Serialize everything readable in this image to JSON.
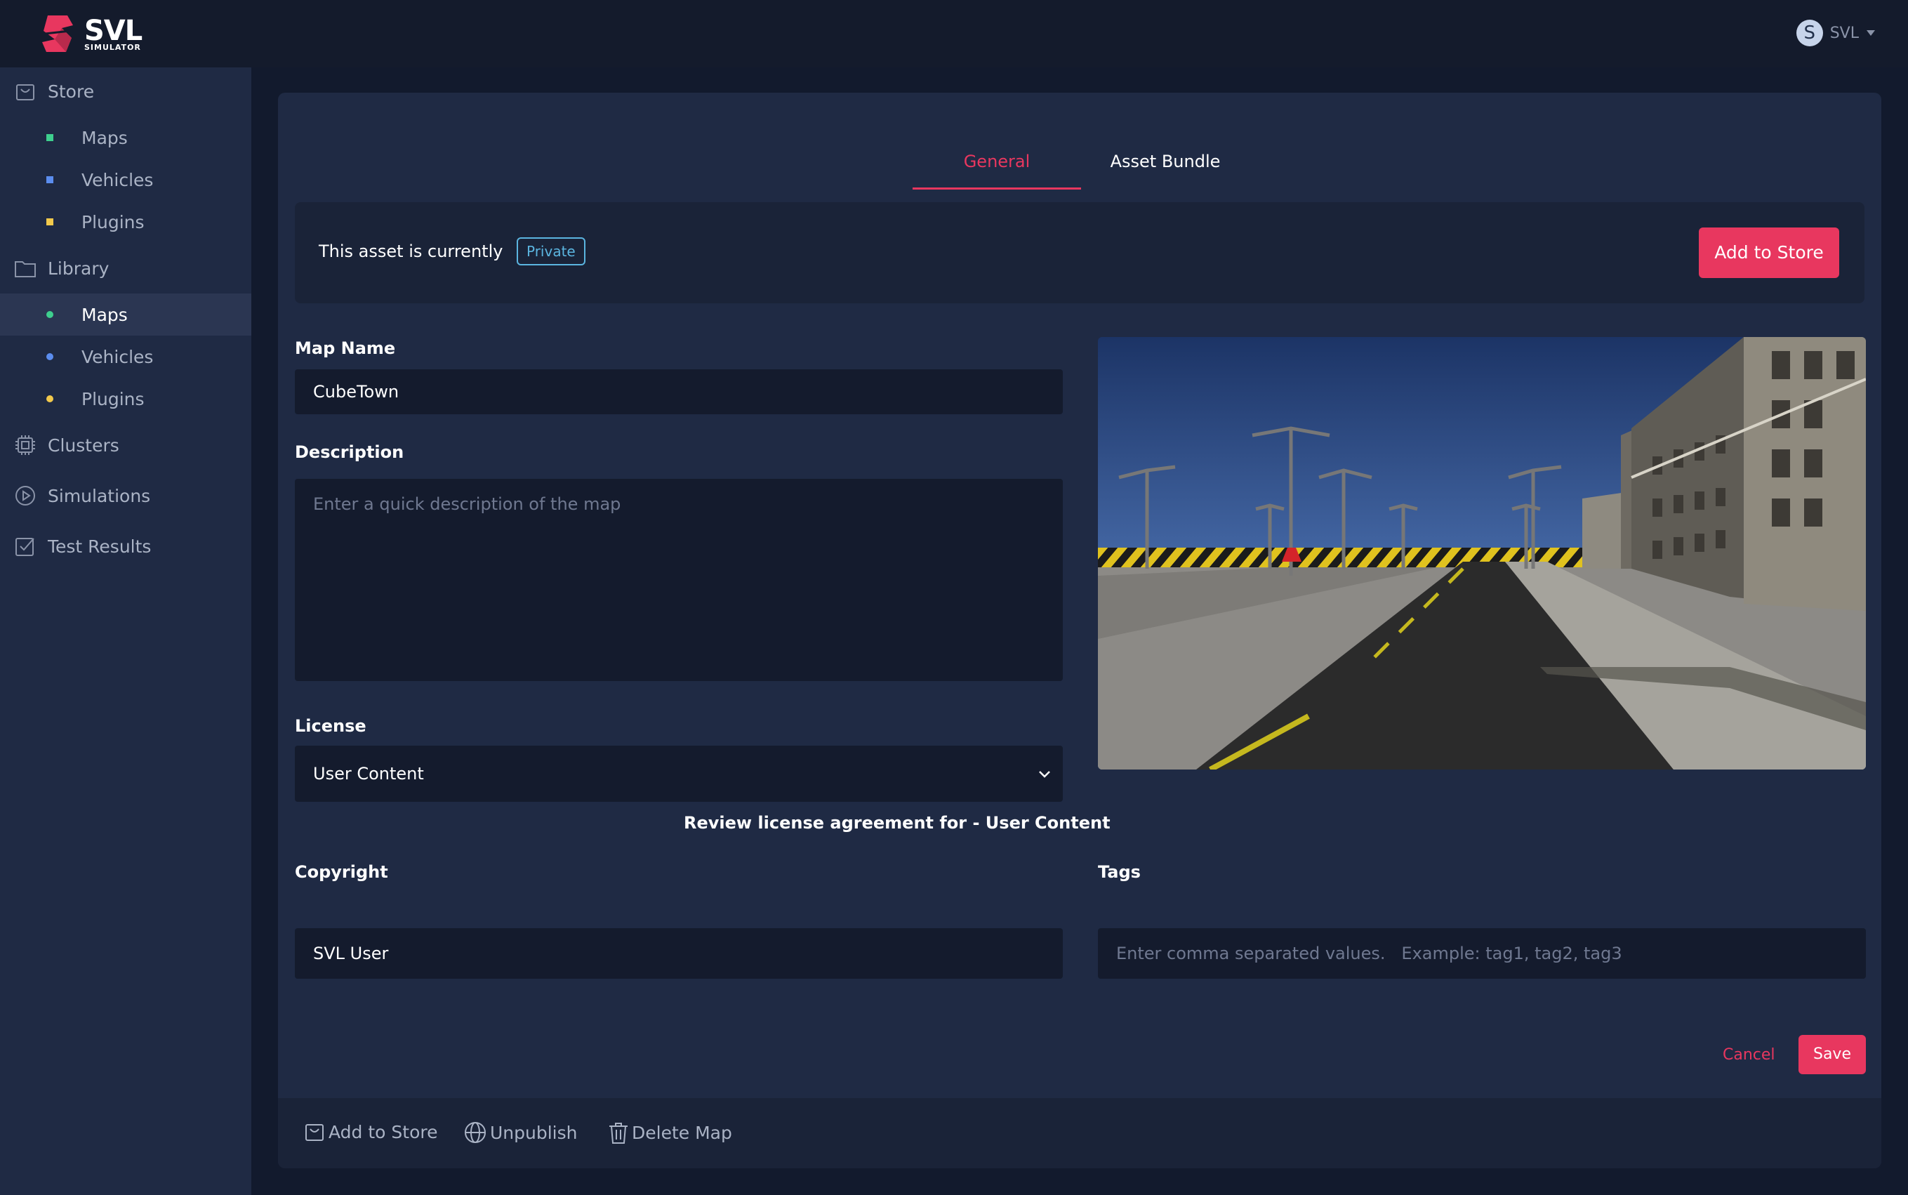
{
  "header": {
    "logo_main": "SVL",
    "logo_sub": "SIMULATOR",
    "user_initial": "S",
    "user_name": "SVL"
  },
  "sidebar": {
    "store": {
      "label": "Store",
      "icon": "bag-icon",
      "items": [
        {
          "label": "Maps",
          "bullet_color": "#3ecf8e"
        },
        {
          "label": "Vehicles",
          "bullet_color": "#5b8def"
        },
        {
          "label": "Plugins",
          "bullet_color": "#f2c94c"
        }
      ]
    },
    "library": {
      "label": "Library",
      "icon": "folder-icon",
      "items": [
        {
          "label": "Maps",
          "bullet_color": "#3ecf8e",
          "active": true
        },
        {
          "label": "Vehicles",
          "bullet_color": "#5b8def"
        },
        {
          "label": "Plugins",
          "bullet_color": "#f2c94c"
        }
      ]
    },
    "clusters": {
      "label": "Clusters",
      "icon": "chip-icon"
    },
    "simulations": {
      "label": "Simulations",
      "icon": "play-icon"
    },
    "test_results": {
      "label": "Test Results",
      "icon": "checkbox-icon"
    }
  },
  "tabs": [
    {
      "label": "General",
      "active": true
    },
    {
      "label": "Asset Bundle",
      "active": false
    }
  ],
  "status": {
    "text": "This asset is currently",
    "badge": "Private",
    "add_button": "Add to Store"
  },
  "form": {
    "map_name_label": "Map Name",
    "map_name_value": "CubeTown",
    "description_label": "Description",
    "description_placeholder": "Enter a quick description of the map",
    "license_label": "License",
    "license_value": "User Content",
    "license_link": "Review license agreement for - User Content",
    "copyright_label": "Copyright",
    "copyright_value": "SVL User",
    "tags_label": "Tags",
    "tags_placeholder": "Enter comma separated values.   Example: tag1, tag2, tag3",
    "cancel": "Cancel",
    "save": "Save"
  },
  "footer": {
    "add_to_store": "Add to Store",
    "unpublish": "Unpublish",
    "delete_map": "Delete Map"
  },
  "colors": {
    "accent": "#e8375f",
    "badge": "#5bb5e0"
  }
}
